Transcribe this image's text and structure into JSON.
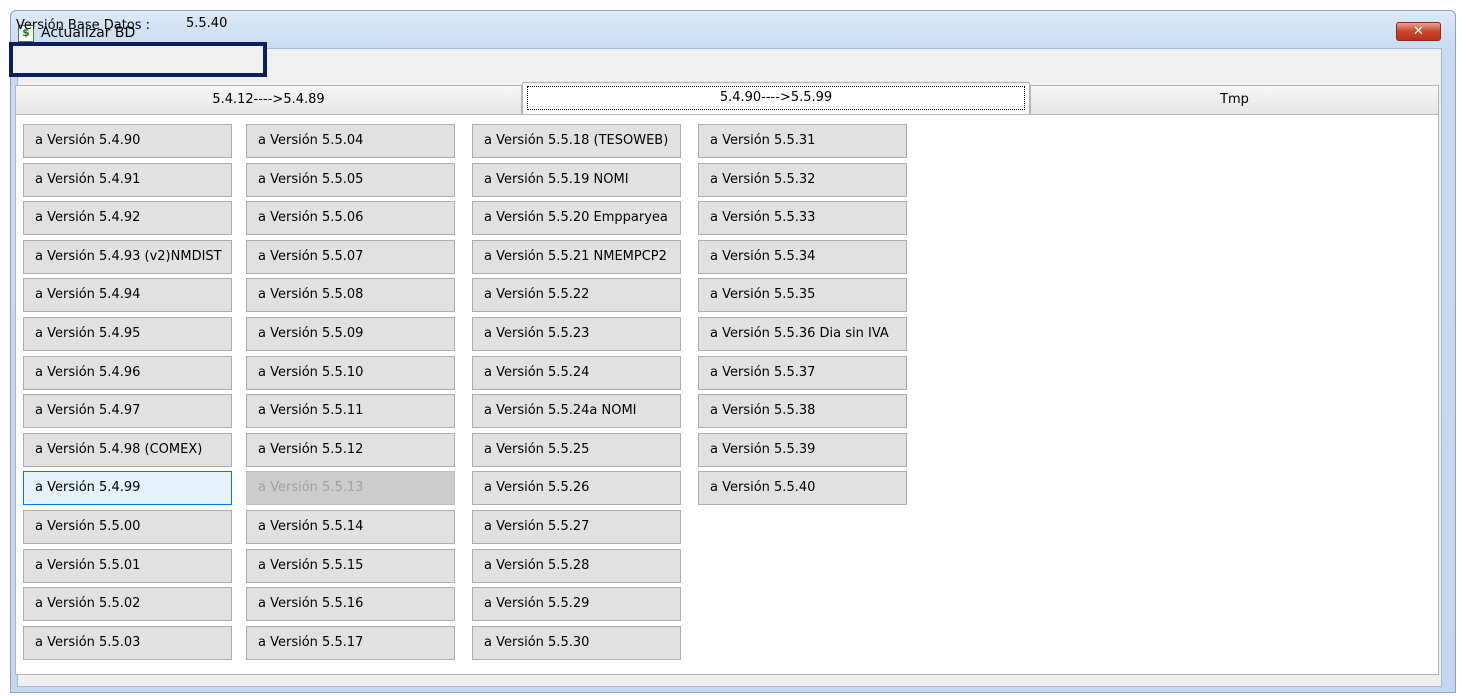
{
  "window": {
    "title": "Actualizar BD",
    "close_label": "✕"
  },
  "db_version": {
    "label": "Versión Base Datos :",
    "value": "5.5.40"
  },
  "tabs": [
    {
      "label": "5.4.12---->5.4.89",
      "active": false
    },
    {
      "label": "5.4.90---->5.5.99",
      "active": true
    },
    {
      "label": "Tmp",
      "active": false
    }
  ],
  "buttons": {
    "col1": [
      "a Versión 5.4.90",
      "a Versión 5.4.91",
      "a Versión 5.4.92",
      "a Versión 5.4.93 (v2)NMDIST",
      "a Versión 5.4.94",
      "a Versión 5.4.95",
      "a Versión 5.4.96",
      "a Versión 5.4.97",
      "a Versión 5.4.98 (COMEX)",
      "a Versión 5.4.99",
      "a Versión 5.5.00",
      "a Versión 5.5.01",
      "a Versión 5.5.02",
      "a Versión 5.5.03"
    ],
    "col2": [
      "a Versión 5.5.04",
      "a Versión 5.5.05",
      "a Versión 5.5.06",
      "a Versión 5.5.07",
      "a Versión 5.5.08",
      "a Versión 5.5.09",
      "a Versión 5.5.10",
      "a Versión 5.5.11",
      "a Versión 5.5.12",
      "a Versión 5.5.13",
      "a Versión 5.5.14",
      "a Versión 5.5.15",
      "a Versión 5.5.16",
      "a Versión 5.5.17"
    ],
    "col3": [
      "a Versión 5.5.18 (TESOWEB)",
      "a Versión 5.5.19 NOMI",
      "a Versión 5.5.20 Empparyea",
      "a Versión 5.5.21 NMEMPCP2",
      "a Versión 5.5.22",
      "a Versión 5.5.23",
      "a Versión 5.5.24",
      "a Versión 5.5.24a NOMI",
      "a Versión 5.5.25",
      "a Versión 5.5.26",
      "a Versión 5.5.27",
      "a Versión 5.5.28",
      "a Versión 5.5.29",
      "a Versión 5.5.30"
    ],
    "col4": [
      "a Versión 5.5.31",
      "a Versión 5.5.32",
      "a Versión 5.5.33",
      "a Versión 5.5.34",
      "a Versión 5.5.35",
      "a Versión 5.5.36 Dia sin IVA",
      "a Versión 5.5.37",
      "a Versión 5.5.38",
      "a Versión 5.5.39",
      "a Versión 5.5.40"
    ],
    "focused": "a Versión 5.4.99",
    "disabled": "a Versión 5.5.13"
  }
}
